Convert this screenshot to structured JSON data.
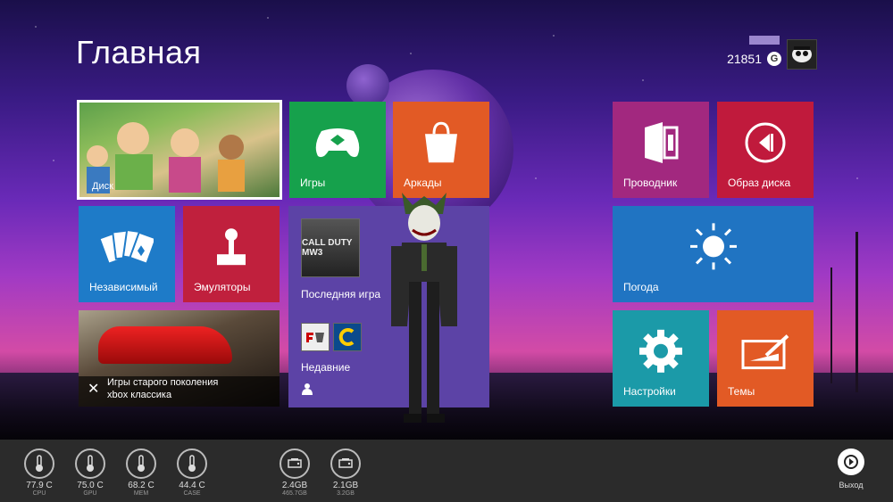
{
  "header": {
    "title": "Главная",
    "gamerscore": "21851",
    "gamerscore_badge": "G"
  },
  "tiles": {
    "disk": "Диск",
    "games": "Игры",
    "arcade": "Аркады",
    "explorer": "Проводник",
    "disc_image": "Образ диска",
    "indie": "Независимый",
    "emulators": "Эмуляторы",
    "last_game": "Последняя игра",
    "last_game_cover": "CALL DUTY MW3",
    "recent": "Недавние",
    "weather": "Погода",
    "legacy_line1": "Игры старого поколения",
    "legacy_line2": "xbox классика",
    "settings": "Настройки",
    "themes": "Темы"
  },
  "colors": {
    "games": "#16a14c",
    "arcade": "#e25a25",
    "explorer": "#a2287f",
    "disc_image": "#c01a3c",
    "indie": "#1e7bc8",
    "emulators": "#c0203d",
    "last_game": "#5c43a6",
    "weather": "#2074c2",
    "settings": "#1b9aa8",
    "themes": "#e25a25",
    "status_bar": "#2b2b2b"
  },
  "status": {
    "cpu": {
      "value": "77.9 C",
      "label": "CPU"
    },
    "gpu": {
      "value": "75.0 C",
      "label": "GPU"
    },
    "mem": {
      "value": "68.2 C",
      "label": "MEM"
    },
    "case": {
      "value": "44.4 C",
      "label": "CASE"
    },
    "hdd1": {
      "value": "2.4GB",
      "sub": "465.7GB"
    },
    "hdd2": {
      "value": "2.1GB",
      "sub": "3.2GB"
    },
    "exit": "Выход"
  }
}
